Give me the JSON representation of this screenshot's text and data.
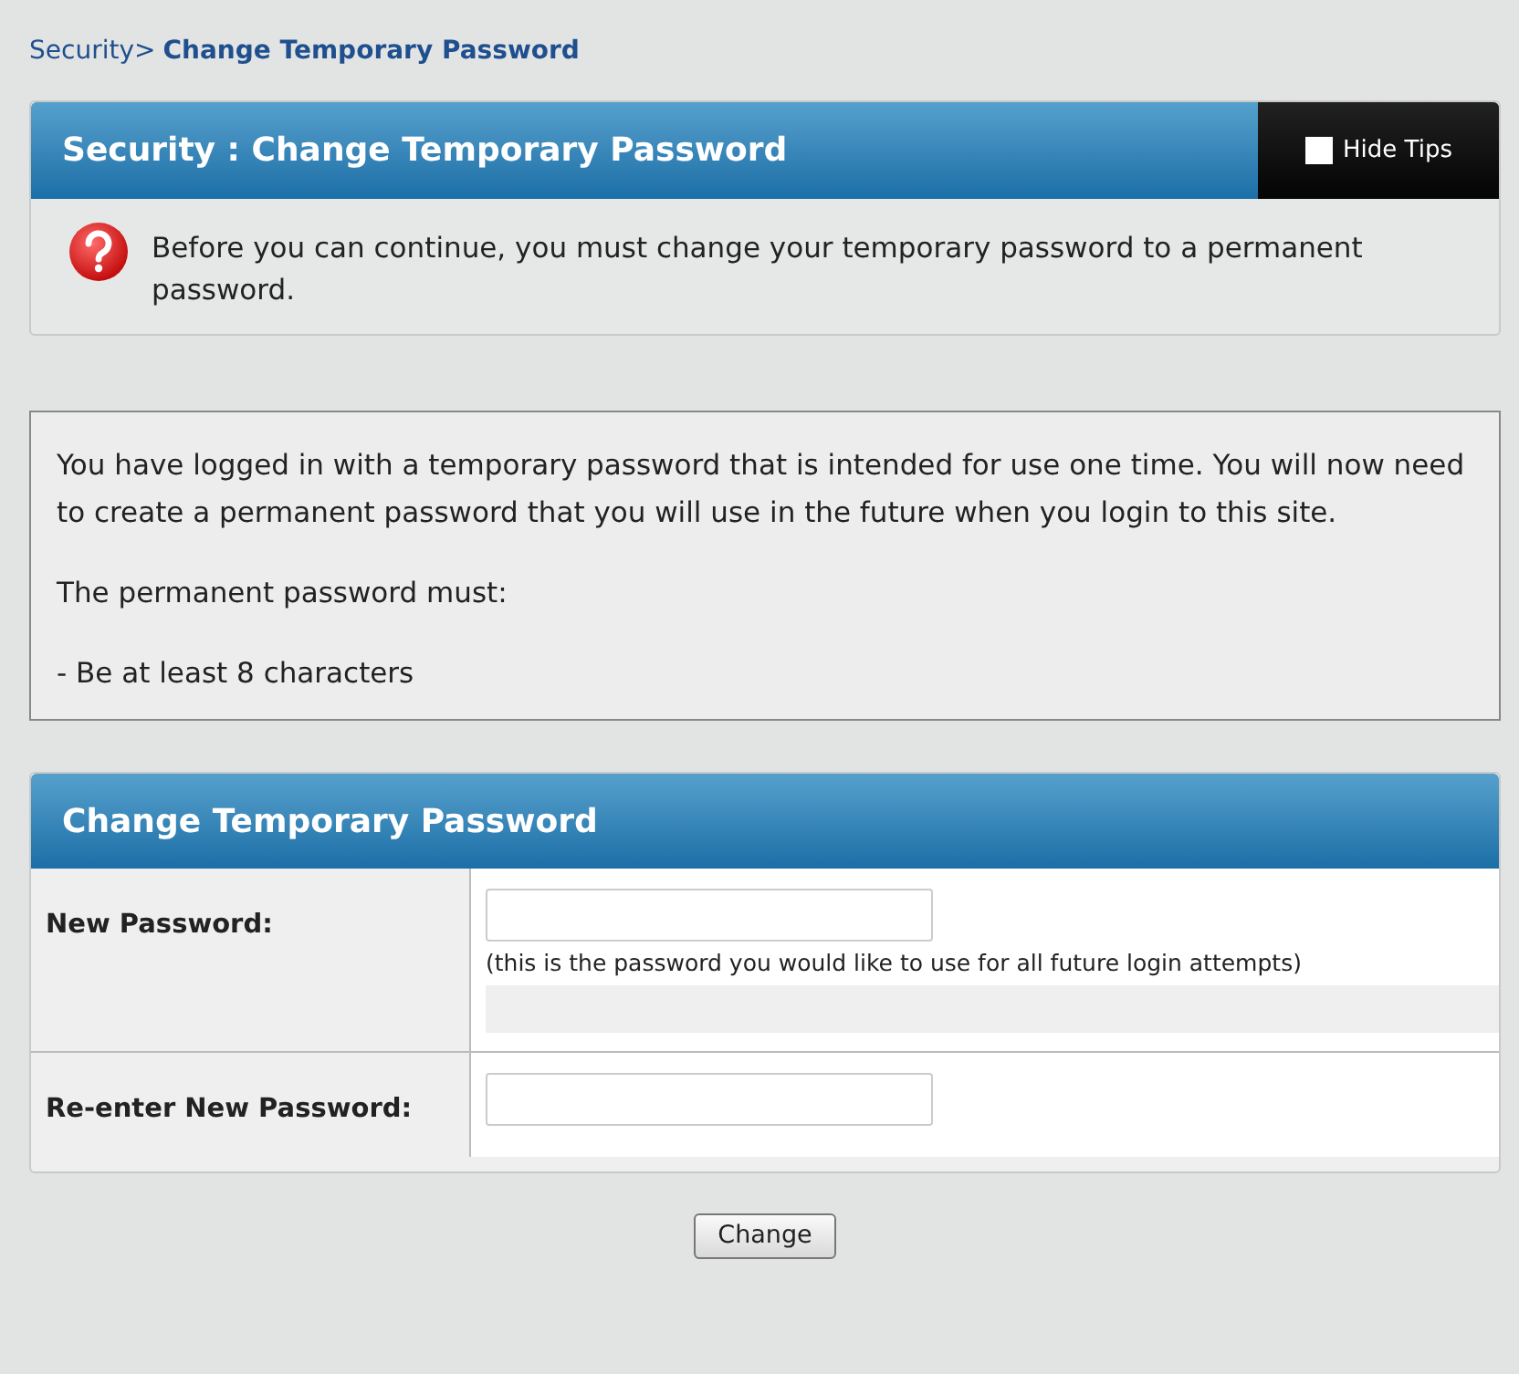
{
  "breadcrumb": {
    "parent": "Security>",
    "current": "Change Temporary Password"
  },
  "header_panel": {
    "title": "Security : Change Temporary Password",
    "hide_tips": {
      "label": "Hide Tips",
      "checked": false
    },
    "tip": "Before you can continue, you must change your temporary password to a permanent password."
  },
  "info_box": {
    "paragraphs": [
      "You have logged in with a temporary password that is intended for use one time. You will now need to create a permanent password that you will use in the future when you login to this site.",
      "The permanent password must:",
      "- Be at least 8 characters"
    ]
  },
  "form": {
    "title": "Change Temporary Password",
    "rows": [
      {
        "label": "New Password:",
        "hint": "(this is the password you would like to use for all future login attempts)"
      },
      {
        "label": "Re-enter New Password:"
      }
    ]
  },
  "submit_button": "Change"
}
